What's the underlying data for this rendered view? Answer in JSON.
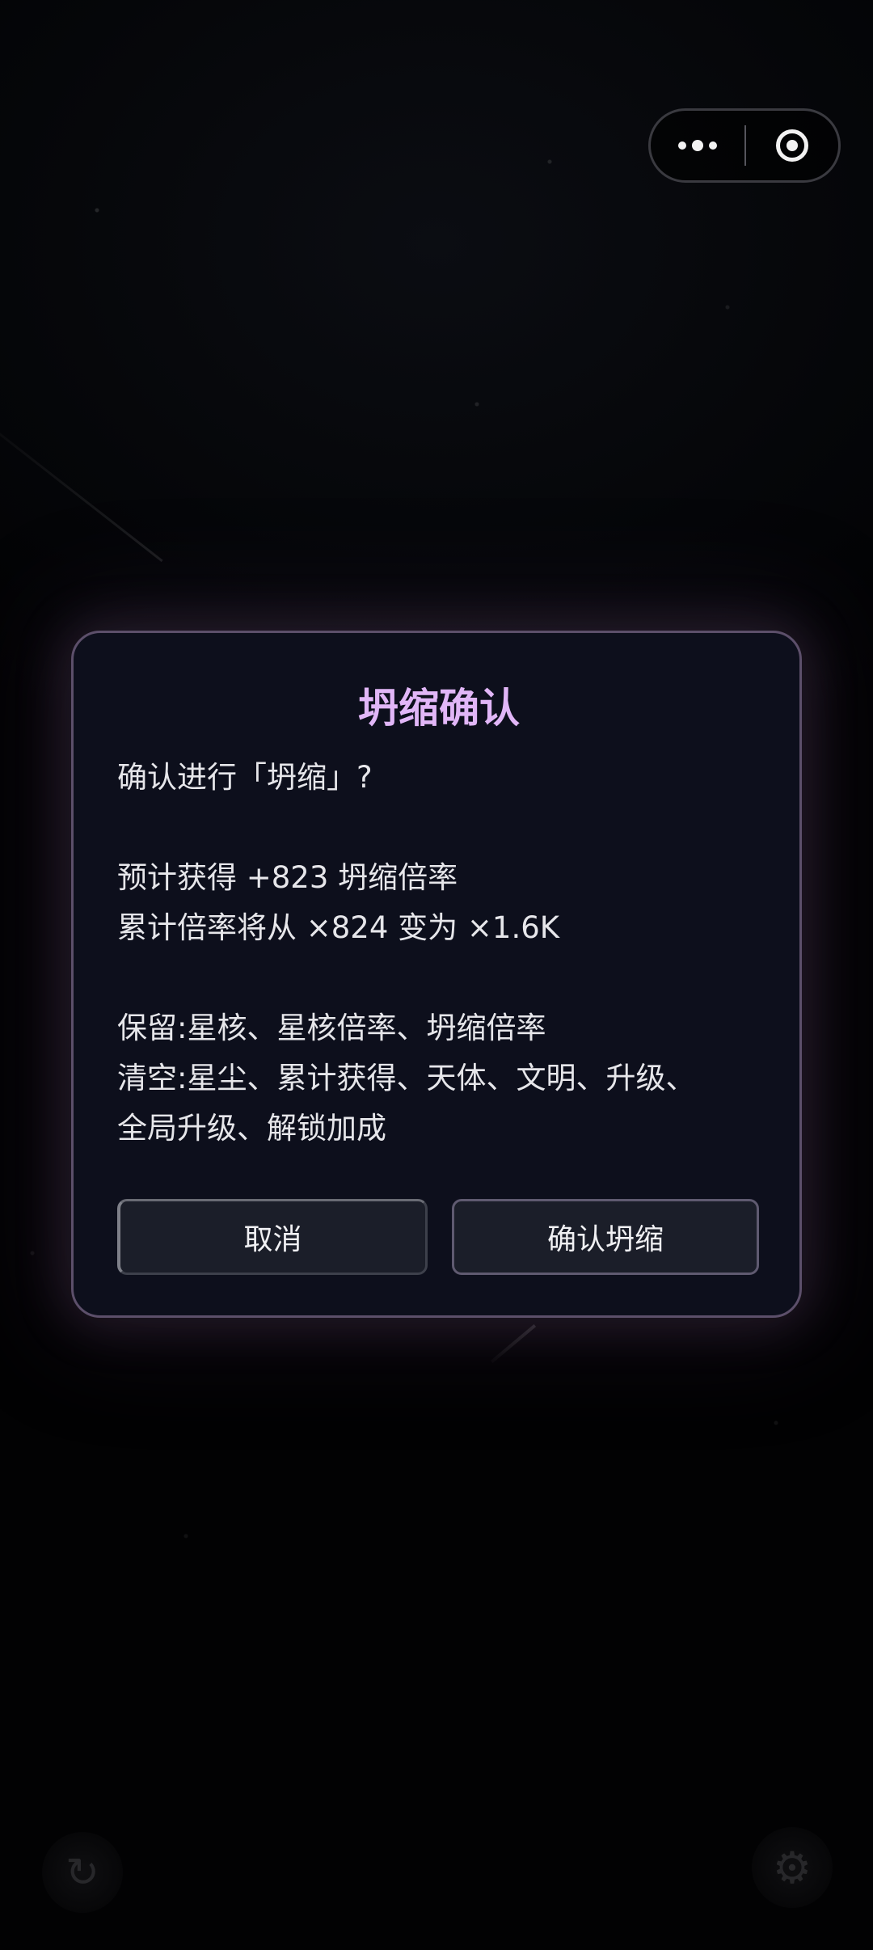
{
  "dialog": {
    "title": "坍缩确认",
    "question": "确认进行「坍缩」?",
    "gain_line": "预计获得 +823 坍缩倍率",
    "multiplier_line": "累计倍率将从 ×824 变为 ×1.6K",
    "keep_line": "保留:星核、星核倍率、坍缩倍率",
    "clear_line_1": "清空:星尘、累计获得、天体、文明、升级、",
    "clear_line_2": "全局升级、解锁加成",
    "cancel_label": "取消",
    "confirm_label": "确认坍缩"
  },
  "capsule": {
    "more_icon": "more-dots-icon",
    "close_icon": "target-ring-icon"
  },
  "background_controls": {
    "left_icon": "refresh-icon",
    "right_icon": "gear-icon"
  }
}
